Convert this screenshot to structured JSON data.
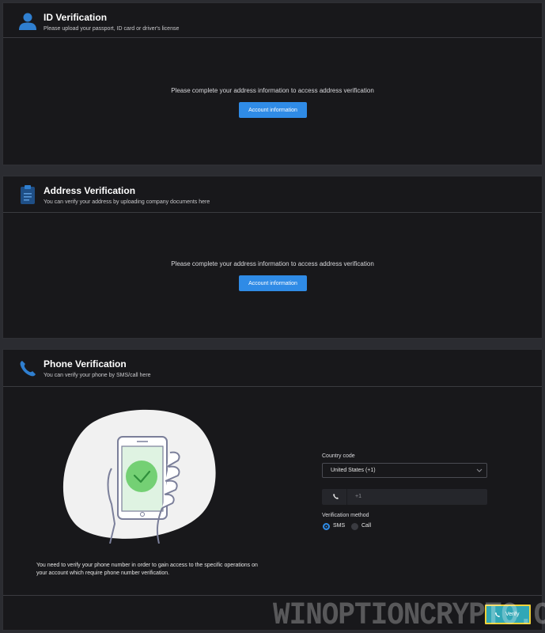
{
  "id_verification": {
    "title": "ID Verification",
    "subtitle": "Please upload your passport, ID card or driver's license",
    "message": "Please complete your address information to access address verification",
    "button_label": "Account information"
  },
  "address_verification": {
    "title": "Address Verification",
    "subtitle": "You can verify your address by uploading company documents here",
    "message": "Please complete your address information to access address verification",
    "button_label": "Account information"
  },
  "phone_verification": {
    "title": "Phone Verification",
    "subtitle": "You can verify your phone by SMS/call here",
    "country_code_label": "Country code",
    "country_code_value": "United States (+1)",
    "phone_prefix": "+1",
    "method_label": "Verification method",
    "methods": [
      {
        "label": "SMS",
        "selected": true
      },
      {
        "label": "Call",
        "selected": false
      }
    ],
    "description": "You need to verify your phone number in order to gain access to the specific operations on your account which require phone number verification.",
    "verify_label": "Verify"
  },
  "watermark": "WINOPTIONCRYPTO.COM",
  "colors": {
    "accent": "#2f8be6",
    "verify_button": "#31a7b6",
    "highlight": "#f2d33b",
    "card_bg": "#18181b",
    "page_bg": "#2b2c31"
  },
  "icons": {
    "id": "user-icon",
    "address": "clipboard-icon",
    "phone": "phone-icon"
  }
}
